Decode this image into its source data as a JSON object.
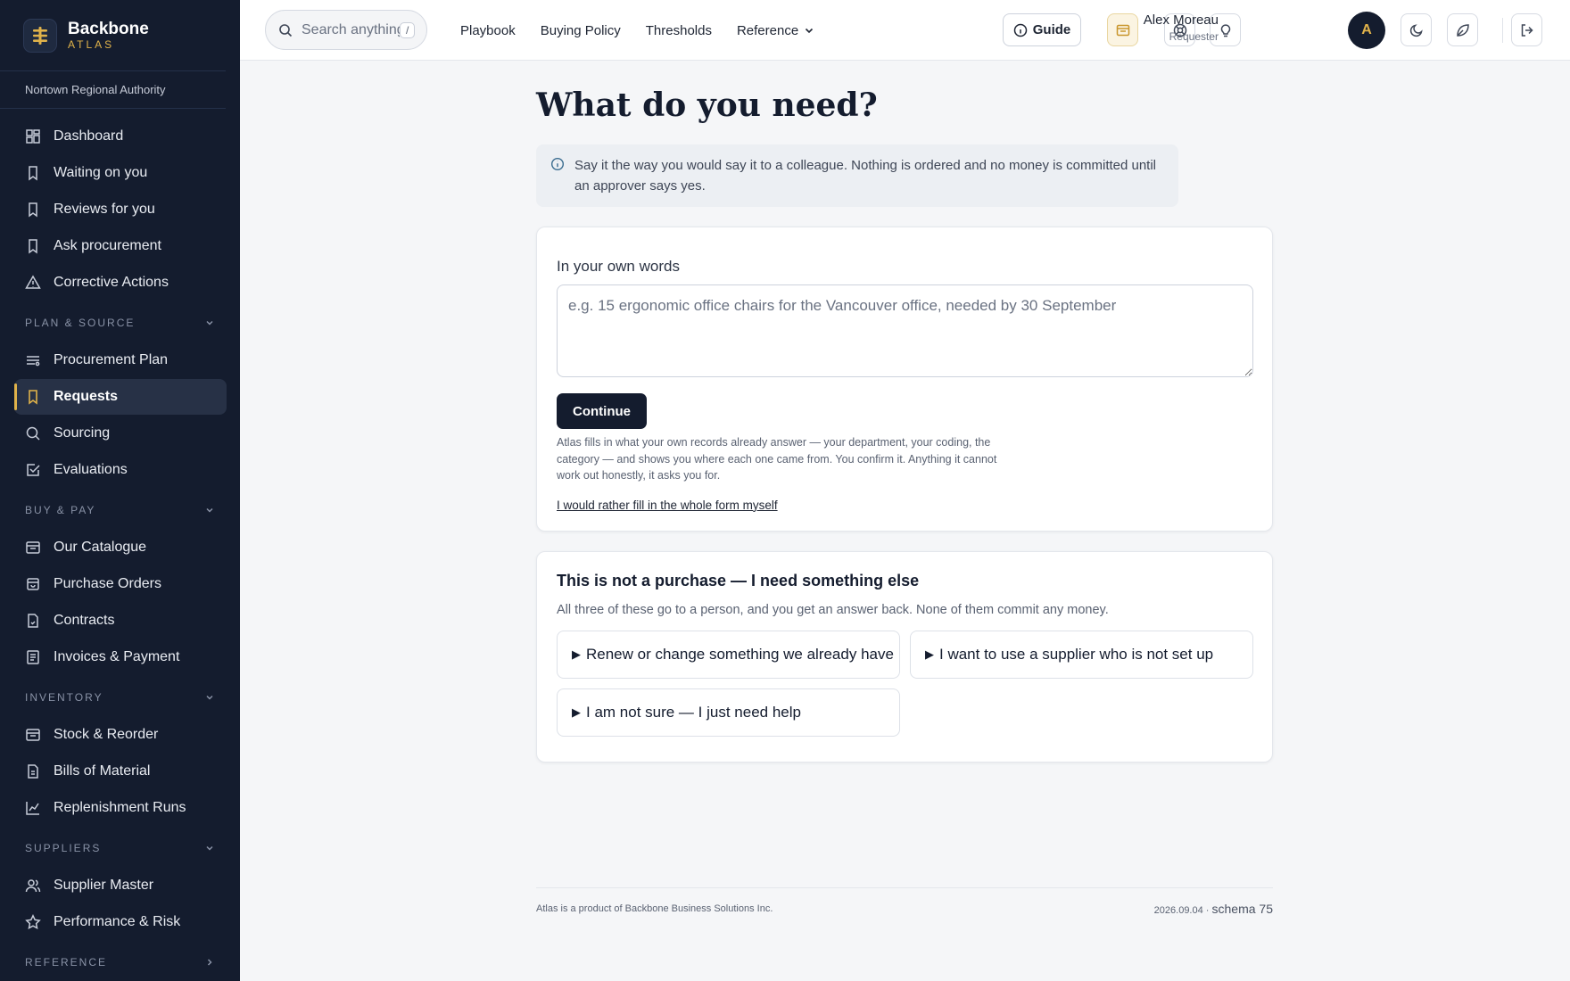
{
  "brand": {
    "name": "Backbone",
    "sub": "ATLAS"
  },
  "org": "Nortown Regional Authority",
  "sidebar": {
    "top_items": [
      {
        "label": "Dashboard",
        "icon": "grid-icon"
      },
      {
        "label": "Waiting on you",
        "icon": "bookmark-icon"
      },
      {
        "label": "Reviews for you",
        "icon": "bookmark-icon"
      },
      {
        "label": "Ask procurement",
        "icon": "bookmark-icon"
      },
      {
        "label": "Corrective Actions",
        "icon": "warning-icon"
      }
    ],
    "sections": [
      {
        "title": "PLAN & SOURCE",
        "items": [
          {
            "label": "Procurement Plan",
            "icon": "list-icon"
          },
          {
            "label": "Requests",
            "icon": "bookmark-icon",
            "active": true
          },
          {
            "label": "Sourcing",
            "icon": "search-icon"
          },
          {
            "label": "Evaluations",
            "icon": "checkbox-icon"
          }
        ]
      },
      {
        "title": "BUY & PAY",
        "items": [
          {
            "label": "Our Catalogue",
            "icon": "catalogue-icon"
          },
          {
            "label": "Purchase Orders",
            "icon": "bag-icon"
          },
          {
            "label": "Contracts",
            "icon": "contract-icon"
          },
          {
            "label": "Invoices & Payment",
            "icon": "invoice-icon"
          }
        ]
      },
      {
        "title": "INVENTORY",
        "items": [
          {
            "label": "Stock & Reorder",
            "icon": "box-icon"
          },
          {
            "label": "Bills of Material",
            "icon": "document-icon"
          },
          {
            "label": "Replenishment Runs",
            "icon": "chart-icon"
          }
        ]
      },
      {
        "title": "SUPPLIERS",
        "items": [
          {
            "label": "Supplier Master",
            "icon": "users-icon"
          },
          {
            "label": "Performance & Risk",
            "icon": "star-icon"
          }
        ]
      },
      {
        "title": "REFERENCE",
        "items": []
      }
    ]
  },
  "topbar": {
    "search_placeholder": "Search anything",
    "search_shortcut": "/",
    "nav": [
      "Playbook",
      "Buying Policy",
      "Thresholds",
      "Reference"
    ],
    "guide_label": "Guide",
    "user_name": "Alex Moreau",
    "user_role": "Requester",
    "avatar_initial": "A"
  },
  "main": {
    "title": "What do you need?",
    "info": "Say it the way you would say it to a colleague. Nothing is ordered and no money is committed until an approver says yes.",
    "own_words_label": "In your own words",
    "textarea_placeholder": "e.g. 15 ergonomic office chairs for the Vancouver office, needed by 30 September",
    "continue_label": "Continue",
    "helper": "Atlas fills in what your own records already answer — your department, your coding, the category — and shows you where each one came from. You confirm it. Anything it cannot work out honestly, it asks you for.",
    "manual_link": "I would rather fill in the whole form myself",
    "other_title": "This is not a purchase — I need something else",
    "other_sub": "All three of these go to a person, and you get an answer back. None of them commit any money.",
    "options": [
      "Renew or change something we already have",
      "I want to use a supplier who is not set up",
      "I am not sure — I just need help"
    ]
  },
  "footer": {
    "left": "Atlas is a product of Backbone Business Solutions Inc.",
    "version": "2026.09.04 ·",
    "schema": "schema 75"
  },
  "colors": {
    "sidebar_bg": "#141c2e",
    "accent": "#e0b24a",
    "primary": "#141c2e"
  }
}
